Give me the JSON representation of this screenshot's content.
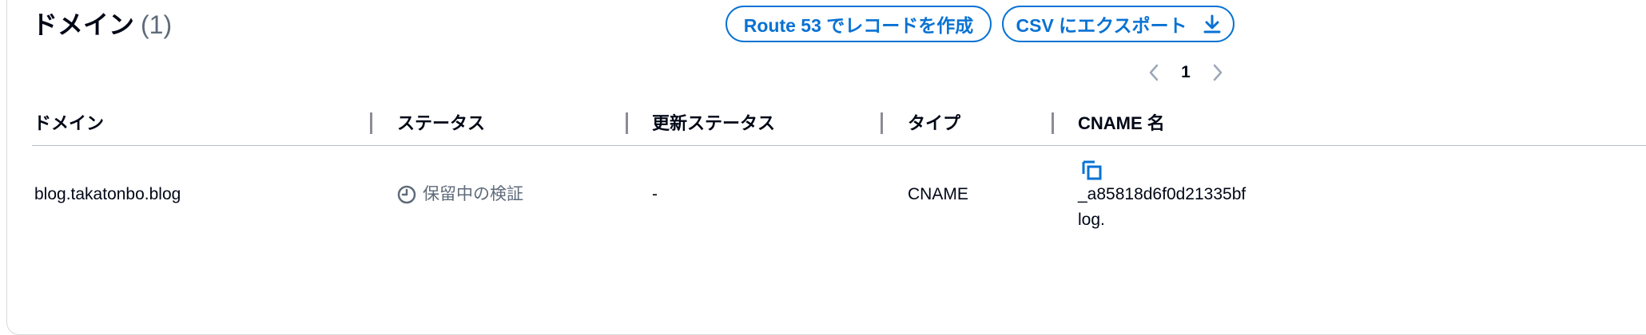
{
  "header": {
    "title": "ドメイン",
    "count": "(1)",
    "route53_button": "Route 53 でレコードを作成",
    "csv_button": "CSV にエクスポート"
  },
  "pagination": {
    "current_page": "1"
  },
  "table": {
    "columns": [
      "ドメイン",
      "ステータス",
      "更新ステータス",
      "タイプ",
      "CNAME 名"
    ],
    "rows": [
      {
        "domain": "blog.takatonbo.blog",
        "status": "保留中の検証",
        "renewal_status": "-",
        "type": "CNAME",
        "cname_line1": "_a85818d6f0d21335bf",
        "cname_line2": "log."
      }
    ]
  },
  "colors": {
    "accent": "#0972d3",
    "text": "#000716",
    "muted": "#5f6b7a",
    "border": "#d5dbdb"
  },
  "icons": [
    "chevron-left-icon",
    "chevron-right-icon",
    "download-icon",
    "clock-icon",
    "copy-icon"
  ]
}
